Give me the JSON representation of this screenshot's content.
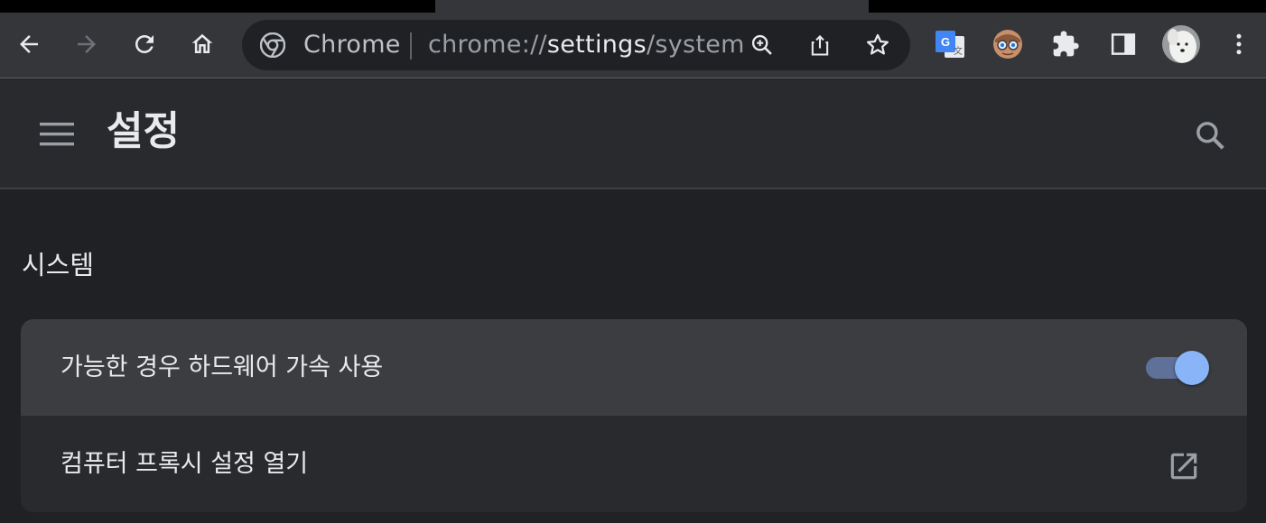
{
  "browser": {
    "nav": {
      "back_icon": "arrow-back-icon",
      "forward_icon": "arrow-forward-icon",
      "reload_icon": "reload-icon",
      "home_icon": "home-icon"
    },
    "omnibox": {
      "site_chip": "Chrome",
      "url_scheme": "chrome://",
      "url_host": "settings",
      "url_path": "/system",
      "actions": [
        "zoom-icon",
        "share-icon",
        "bookmark-star-icon"
      ]
    },
    "extensions": [
      "google-translate-icon",
      "glasses-extension-icon",
      "puzzle-extensions-icon",
      "side-panel-icon",
      "profile-avatar",
      "kebab-menu-icon"
    ]
  },
  "settings": {
    "title": "설정",
    "section_title": "시스템",
    "rows": [
      {
        "label": "가능한 경우 하드웨어 가속 사용",
        "control": "toggle",
        "checked": true
      },
      {
        "label": "컴퓨터 프록시 설정 열기",
        "control": "external-link"
      }
    ]
  },
  "colors": {
    "accent": "#8ab4f8",
    "page_bg": "#202124",
    "card_bg": "#292a2d",
    "toolbar_bg": "#35363a"
  }
}
